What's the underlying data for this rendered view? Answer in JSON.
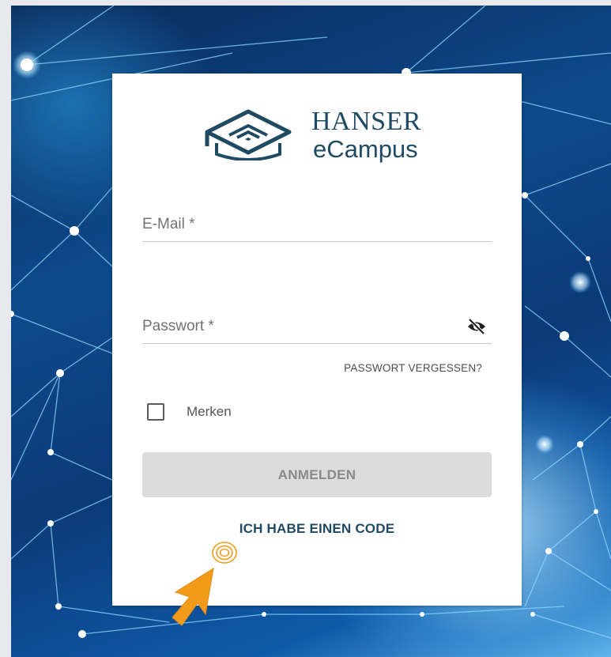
{
  "brand": {
    "name_top": "HANSER",
    "name_bottom": "eCampus",
    "logo_icon": "graduation-cap-logo-icon",
    "color": "#1f4a63"
  },
  "login_form": {
    "email": {
      "placeholder": "E-Mail *",
      "value": ""
    },
    "password": {
      "placeholder": "Passwort *",
      "value": "",
      "toggle_icon": "eye-off-icon"
    },
    "forgot_password_label": "PASSWORT VERGESSEN?",
    "remember": {
      "label": "Merken",
      "checked": false
    },
    "submit_label": "ANMELDEN",
    "submit_enabled": false,
    "code_link_label": "ICH HABE EINEN CODE"
  },
  "annotation": {
    "icon": "orange-arrow-pointer-icon",
    "color": "#f29a1a"
  },
  "background": {
    "theme": "blue-network-mesh",
    "accent": "#0d4a8c"
  }
}
